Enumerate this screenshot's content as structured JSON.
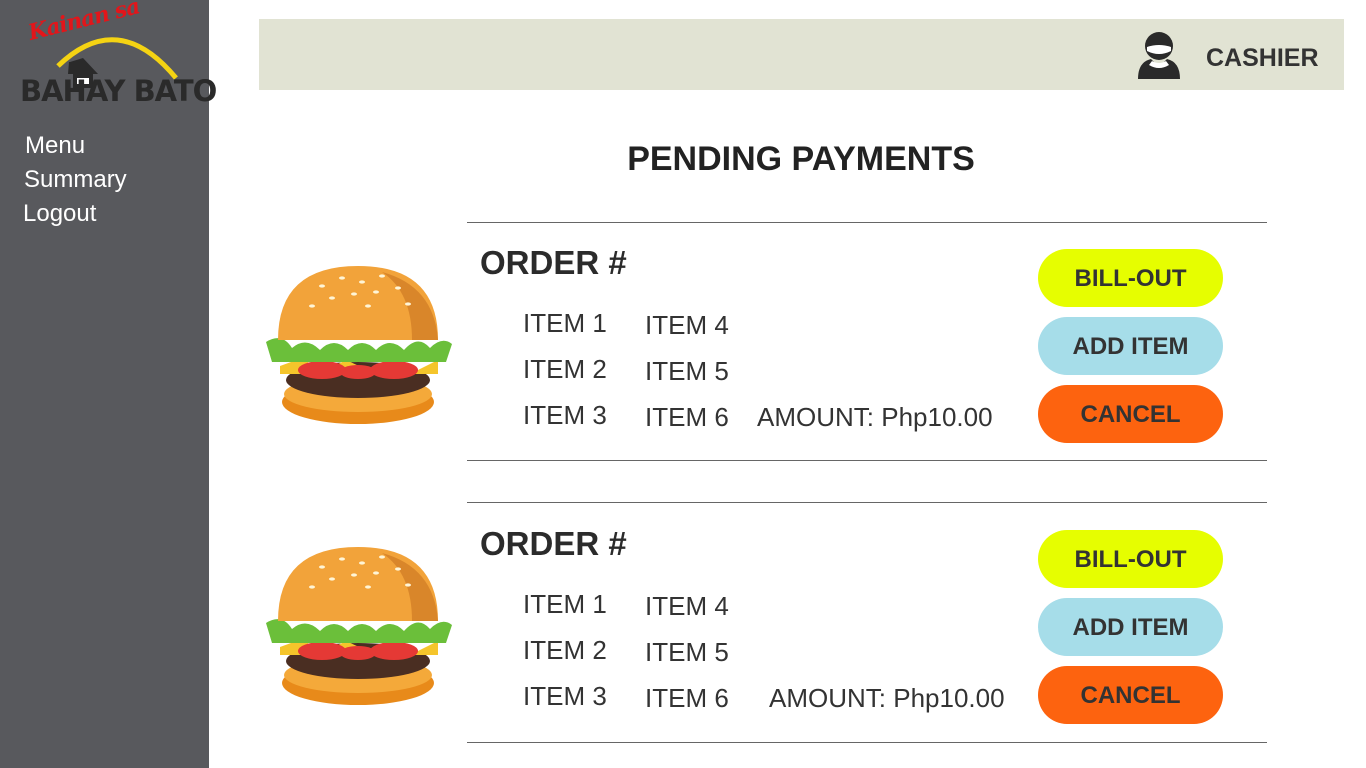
{
  "brand": {
    "script_text": "Kainan sa",
    "main_text": "BAHAY BATO"
  },
  "sidebar": {
    "items": [
      {
        "label": "Menu"
      },
      {
        "label": "Summary"
      },
      {
        "label": "Logout"
      }
    ]
  },
  "header": {
    "user_icon": "user-icon",
    "user_label": "CASHIER"
  },
  "page": {
    "title": "PENDING PAYMENTS"
  },
  "orders": [
    {
      "title": "ORDER #",
      "image": "burger-icon",
      "items_col1": [
        "ITEM 1",
        "ITEM 2",
        "ITEM 3"
      ],
      "items_col2": [
        "ITEM 4",
        "ITEM 5",
        "ITEM 6"
      ],
      "amount": "AMOUNT: Php10.00",
      "buttons": {
        "bill_out": "BILL-OUT",
        "add_item": "ADD ITEM",
        "cancel": "CANCEL"
      }
    },
    {
      "title": "ORDER #",
      "image": "burger-icon",
      "items_col1": [
        "ITEM 1",
        "ITEM 2",
        "ITEM 3"
      ],
      "items_col2": [
        "ITEM 4",
        "ITEM 5",
        "ITEM 6"
      ],
      "amount": "AMOUNT: Php10.00",
      "buttons": {
        "bill_out": "BILL-OUT",
        "add_item": "ADD ITEM",
        "cancel": "CANCEL"
      }
    }
  ],
  "colors": {
    "sidebar": "#58595d",
    "header": "#e1e3d3",
    "bill_out": "#e6fe00",
    "add_item": "#a6dde9",
    "cancel": "#fd630f"
  }
}
